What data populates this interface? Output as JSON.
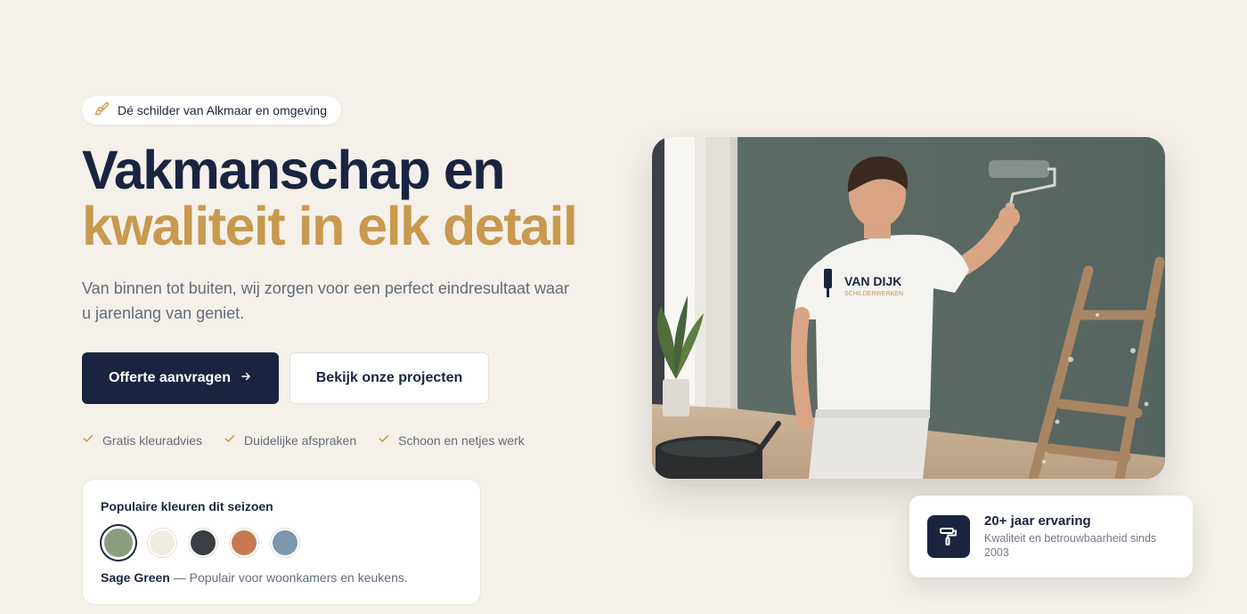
{
  "hero": {
    "badge": "Dé schilder van Alkmaar en omgeving",
    "title_line1": "Vakmanschap en",
    "title_line2": "kwaliteit in elk detail",
    "lead": "Van binnen tot buiten, wij zorgen voor een perfect eindresultaat waar u jarenlang van geniet.",
    "primary_cta": "Offerte aanvragen",
    "secondary_cta": "Bekijk onze projecten",
    "accent_color": "#c8994e",
    "navy_color": "#1a2440"
  },
  "checks": [
    "Gratis kleuradvies",
    "Duidelijke afspraken",
    "Schoon en netjes werk"
  ],
  "colors_card": {
    "title": "Populaire kleuren dit seizoen",
    "swatches": [
      "#8a9e7e",
      "#f1ece2",
      "#3b3f44",
      "#c77a52",
      "#7c97ad"
    ],
    "selected_index": 0,
    "selected_name": "Sage Green",
    "selected_desc": "— Populair voor woonkamers en keukens."
  },
  "photo": {
    "shirt_brand": "VAN DIJK",
    "shirt_sub": "SCHILDERWERKEN"
  },
  "experience_card": {
    "title": "20+ jaar ervaring",
    "subtitle": "Kwaliteit en betrouwbaarheid sinds 2003",
    "icon": "paint-roller-icon"
  }
}
